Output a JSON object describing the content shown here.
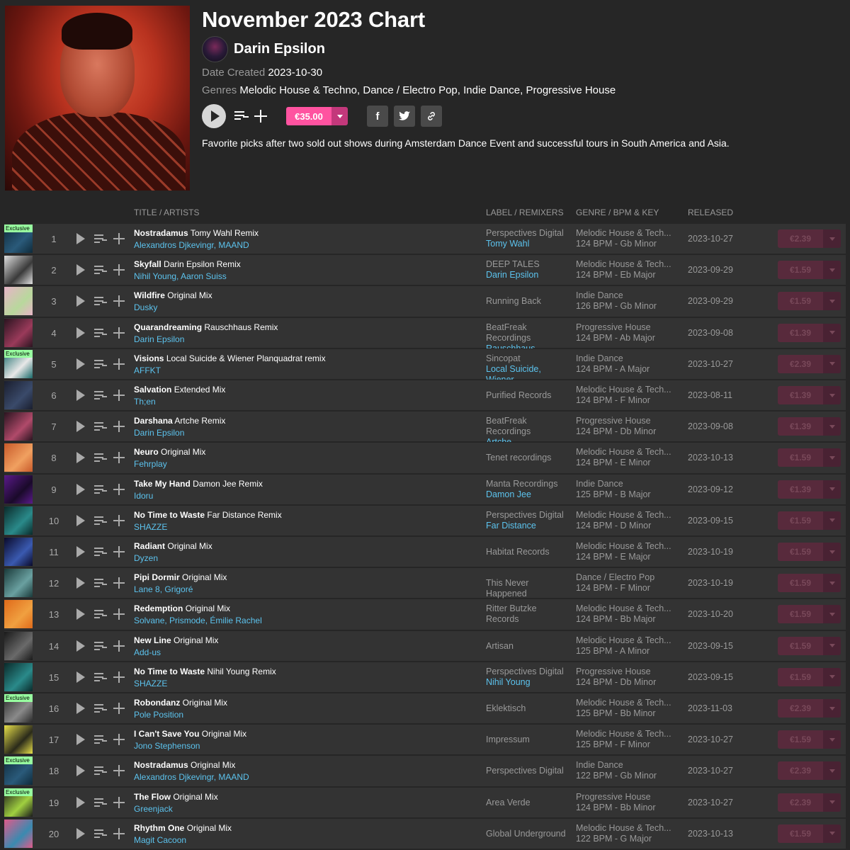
{
  "chart": {
    "title": "November 2023 Chart",
    "artist": "Darin Epsilon",
    "date_label": "Date Created",
    "date": "2023-10-30",
    "genres_label": "Genres",
    "genres": "Melodic House & Techno, Dance / Electro Pop, Indie Dance, Progressive House",
    "price": "€35.00",
    "description": "Favorite picks after two sold out shows during Amsterdam Dance Event and successful tours in South America and Asia."
  },
  "columns": {
    "title": "TITLE / ARTISTS",
    "label": "LABEL / REMIXERS",
    "genre": "GENRE / BPM & KEY",
    "released": "RELEASED"
  },
  "exclusive_label": "Exclusive",
  "tracks": [
    {
      "num": "1",
      "title": "Nostradamus",
      "mix": "Tomy Wahl Remix",
      "artists": "Alexandros Djkevingr, MAAND",
      "label": "Perspectives Digital",
      "remixers": "Tomy Wahl",
      "genre": "Melodic House & Tech...",
      "bpm": "124 BPM - Gb Minor",
      "released": "2023-10-27",
      "price": "€2.39",
      "exclusive": true,
      "art_colors": [
        "#0f2a3a",
        "#2a5a7a"
      ]
    },
    {
      "num": "2",
      "title": "Skyfall",
      "mix": "Darin Epsilon Remix",
      "artists": "Nihil Young, Aaron Suiss",
      "label": "DEEP TALES",
      "remixers": "Darin Epsilon",
      "genre": "Melodic House & Tech...",
      "bpm": "124 BPM - Eb Major",
      "released": "2023-09-29",
      "price": "€1.59",
      "exclusive": false,
      "art_colors": [
        "#e0e0e0",
        "#3a3a3a"
      ]
    },
    {
      "num": "3",
      "title": "Wildfire",
      "mix": "Original Mix",
      "artists": "Dusky",
      "label": "Running Back",
      "remixers": "",
      "genre": "Indie Dance",
      "bpm": "126 BPM - Gb Minor",
      "released": "2023-09-29",
      "price": "€1.59",
      "exclusive": false,
      "art_colors": [
        "#e8b4c8",
        "#b8d89c"
      ]
    },
    {
      "num": "4",
      "title": "Quarandreaming",
      "mix": "Rauschhaus Remix",
      "artists": "Darin Epsilon",
      "label": "BeatFreak Recordings",
      "remixers": "Rauschhaus",
      "genre": "Progressive House",
      "bpm": "124 BPM - Ab Major",
      "released": "2023-09-08",
      "price": "€1.39",
      "exclusive": false,
      "art_colors": [
        "#2a1420",
        "#9a3a5a"
      ]
    },
    {
      "num": "5",
      "title": "Visions",
      "mix": "Local Suicide & Wiener Planquadrat remix",
      "artists": "AFFKT",
      "label": "Sincopat",
      "remixers": "Local Suicide, Wiener",
      "genre": "Indie Dance",
      "bpm": "124 BPM - A Major",
      "released": "2023-10-27",
      "price": "€2.39",
      "exclusive": true,
      "art_colors": [
        "#1a6a6a",
        "#e8e8e8"
      ]
    },
    {
      "num": "6",
      "title": "Salvation",
      "mix": "Extended Mix",
      "artists": "Th;en",
      "label": "Purified Records",
      "remixers": "",
      "genre": "Melodic House & Tech...",
      "bpm": "124 BPM - F Minor",
      "released": "2023-08-11",
      "price": "€1.39",
      "exclusive": false,
      "art_colors": [
        "#1a1e2e",
        "#3a4a6a"
      ]
    },
    {
      "num": "7",
      "title": "Darshana",
      "mix": "Artche Remix",
      "artists": "Darin Epsilon",
      "label": "BeatFreak Recordings",
      "remixers": "Artche",
      "genre": "Progressive House",
      "bpm": "124 BPM - Db Minor",
      "released": "2023-09-08",
      "price": "€1.39",
      "exclusive": false,
      "art_colors": [
        "#2a1420",
        "#b04a6a"
      ]
    },
    {
      "num": "8",
      "title": "Neuro",
      "mix": "Original Mix",
      "artists": "Fehrplay",
      "label": "Tenet recordings",
      "remixers": "",
      "genre": "Melodic House & Tech...",
      "bpm": "124 BPM - E Minor",
      "released": "2023-10-13",
      "price": "€1.59",
      "exclusive": false,
      "art_colors": [
        "#c85a2a",
        "#f0a060"
      ]
    },
    {
      "num": "9",
      "title": "Take My Hand",
      "mix": "Damon Jee Remix",
      "artists": "Idoru",
      "label": "Manta Recordings",
      "remixers": "Damon Jee",
      "genre": "Indie Dance",
      "bpm": "125 BPM - B Major",
      "released": "2023-09-12",
      "price": "€1.39",
      "exclusive": false,
      "art_colors": [
        "#5a1a8a",
        "#1a0a2a"
      ]
    },
    {
      "num": "10",
      "title": "No Time to Waste",
      "mix": "Far Distance Remix",
      "artists": "SHAZZE",
      "label": "Perspectives Digital",
      "remixers": "Far Distance",
      "genre": "Melodic House & Tech...",
      "bpm": "124 BPM - D Minor",
      "released": "2023-09-15",
      "price": "€1.59",
      "exclusive": false,
      "art_colors": [
        "#0a2a2a",
        "#2a8a8a"
      ]
    },
    {
      "num": "11",
      "title": "Radiant",
      "mix": "Original Mix",
      "artists": "Dyzen",
      "label": "Habitat Records",
      "remixers": "",
      "genre": "Melodic House & Tech...",
      "bpm": "124 BPM - E Major",
      "released": "2023-10-19",
      "price": "€1.59",
      "exclusive": false,
      "art_colors": [
        "#0a0a2a",
        "#3a5ab0"
      ]
    },
    {
      "num": "12",
      "title": "Pipi Dormir",
      "mix": "Original Mix",
      "artists": "Lane 8, Grigoré",
      "label": "This Never Happened",
      "remixers": "",
      "genre": "Dance / Electro Pop",
      "bpm": "124 BPM - F Minor",
      "released": "2023-10-19",
      "price": "€1.59",
      "exclusive": false,
      "art_colors": [
        "#1a3a3a",
        "#6aa0a0"
      ]
    },
    {
      "num": "13",
      "title": "Redemption",
      "mix": "Original Mix",
      "artists": "Solvane, Prismode, Émilie Rachel",
      "label": "Ritter Butzke Records",
      "remixers": "",
      "genre": "Melodic House & Tech...",
      "bpm": "124 BPM - Bb Major",
      "released": "2023-10-20",
      "price": "€1.59",
      "exclusive": false,
      "art_colors": [
        "#e06a1a",
        "#f0a040"
      ]
    },
    {
      "num": "14",
      "title": "New Line",
      "mix": "Original Mix",
      "artists": "Add-us",
      "label": "Artisan",
      "remixers": "",
      "genre": "Melodic House & Tech...",
      "bpm": "125 BPM - A Minor",
      "released": "2023-09-15",
      "price": "€1.59",
      "exclusive": false,
      "art_colors": [
        "#1a1a1a",
        "#6a6a6a"
      ]
    },
    {
      "num": "15",
      "title": "No Time to Waste",
      "mix": "Nihil Young Remix",
      "artists": "SHAZZE",
      "label": "Perspectives Digital",
      "remixers": "Nihil Young",
      "genre": "Progressive House",
      "bpm": "124 BPM - Db Minor",
      "released": "2023-09-15",
      "price": "€1.59",
      "exclusive": false,
      "art_colors": [
        "#0a2a2a",
        "#2a8a8a"
      ]
    },
    {
      "num": "16",
      "title": "Robondanz",
      "mix": "Original Mix",
      "artists": "Pole Position",
      "label": "Eklektisch",
      "remixers": "",
      "genre": "Melodic House & Tech...",
      "bpm": "125 BPM - Bb Minor",
      "released": "2023-11-03",
      "price": "€2.39",
      "exclusive": true,
      "art_colors": [
        "#2a2a2a",
        "#8a8a8a"
      ]
    },
    {
      "num": "17",
      "title": "I Can't Save You",
      "mix": "Original Mix",
      "artists": "Jono Stephenson",
      "label": "Impressum",
      "remixers": "",
      "genre": "Melodic House & Tech...",
      "bpm": "125 BPM - F Minor",
      "released": "2023-10-27",
      "price": "€1.59",
      "exclusive": false,
      "art_colors": [
        "#e8e04a",
        "#2a2a1a"
      ]
    },
    {
      "num": "18",
      "title": "Nostradamus",
      "mix": "Original Mix",
      "artists": "Alexandros Djkevingr, MAAND",
      "label": "Perspectives Digital",
      "remixers": "",
      "genre": "Indie Dance",
      "bpm": "122 BPM - Gb Minor",
      "released": "2023-10-27",
      "price": "€2.39",
      "exclusive": true,
      "art_colors": [
        "#0f2a3a",
        "#2a5a7a"
      ]
    },
    {
      "num": "19",
      "title": "The Flow",
      "mix": "Original Mix",
      "artists": "Greenjack",
      "label": "Area Verde",
      "remixers": "",
      "genre": "Progressive House",
      "bpm": "124 BPM - Bb Minor",
      "released": "2023-10-27",
      "price": "€2.39",
      "exclusive": true,
      "art_colors": [
        "#1a1a1a",
        "#a0d040"
      ]
    },
    {
      "num": "20",
      "title": "Rhythm One",
      "mix": "Original Mix",
      "artists": "Magit Cacoon",
      "label": "Global Underground",
      "remixers": "",
      "genre": "Melodic House & Tech...",
      "bpm": "122 BPM - G Major",
      "released": "2023-10-13",
      "price": "€1.59",
      "exclusive": false,
      "art_colors": [
        "#e05a8a",
        "#3a8ab0"
      ]
    }
  ]
}
